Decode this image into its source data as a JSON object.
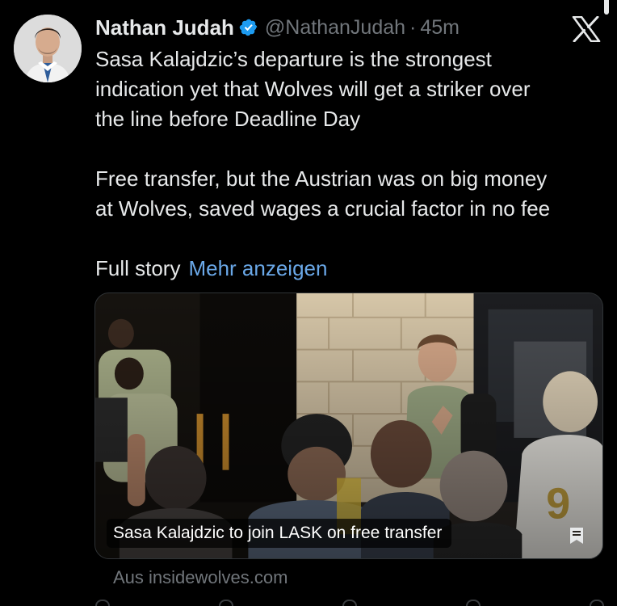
{
  "author": {
    "name": "Nathan Judah",
    "handle": "@NathanJudah",
    "separator": "·",
    "time": "45m",
    "verified": true
  },
  "tweet": {
    "paragraph1": [
      "Sasa Kalajdzic’s departure is the strongest",
      "indication yet that Wolves will get a striker over",
      "the line before Deadline Day"
    ],
    "paragraph2": [
      "Free transfer, but the Austrian was on big money",
      "at Wolves, saved wages a crucial factor in no fee"
    ],
    "full_story_label": "Full story",
    "show_more_label": "Mehr anzeigen"
  },
  "card": {
    "caption": "Sasa Kalajdzic to join LASK on free transfer",
    "source": "Aus insidewolves.com",
    "jersey_number": "9"
  },
  "icons": {
    "verified": "verified-badge-icon",
    "logo": "x-logo-icon",
    "bookmark": "bookmark-icon"
  },
  "colors": {
    "background": "#000000",
    "text": "#e7e9ea",
    "secondary": "#71767b",
    "link": "#6aa8e8",
    "verified": "#1d9bf0"
  }
}
